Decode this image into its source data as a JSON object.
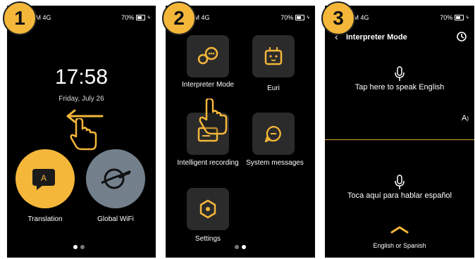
{
  "steps": [
    "1",
    "2",
    "3"
  ],
  "status": {
    "carrier": "SIM 4G",
    "battery": "70%"
  },
  "screen1": {
    "time": "17:58",
    "date": "Friday, July 26",
    "apps": [
      {
        "label": "Translation",
        "icon": "translation-chat-icon"
      },
      {
        "label": "Global WiFi",
        "icon": "airplane-globe-icon"
      }
    ]
  },
  "screen2": {
    "tiles": [
      {
        "label": "Interpreter Mode",
        "icon": "interpreter-icon"
      },
      {
        "label": "Euri",
        "icon": "robot-face-icon"
      },
      {
        "label": "Intelligent recording",
        "icon": "recording-icon"
      },
      {
        "label": "System messages",
        "icon": "message-icon"
      },
      {
        "label": "Settings",
        "icon": "hexagon-settings-icon"
      }
    ]
  },
  "screen3": {
    "title": "Interpreter Mode",
    "prompt_top": "Tap here to speak English",
    "prompt_bottom": "Toca aquí para hablar español",
    "language_select": "English or Spanish"
  },
  "colors": {
    "accent": "#f4b73a",
    "tile": "#2b2b2b",
    "background": "#000000"
  }
}
